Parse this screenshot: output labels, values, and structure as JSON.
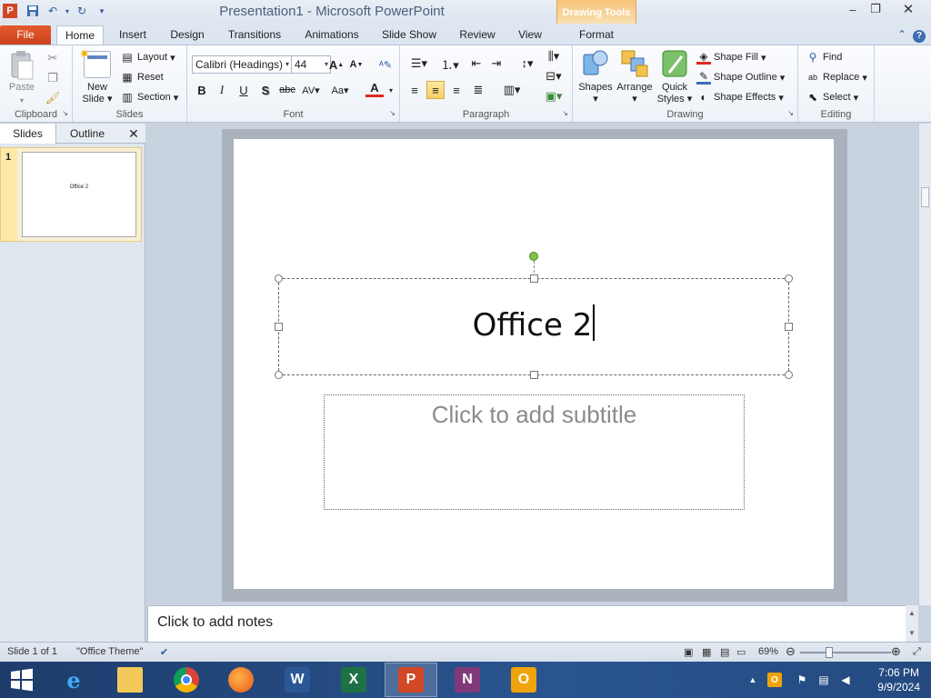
{
  "window": {
    "title": "Presentation1  -  Microsoft PowerPoint",
    "context_tab_group": "Drawing Tools"
  },
  "tabs": [
    "File",
    "Home",
    "Insert",
    "Design",
    "Transitions",
    "Animations",
    "Slide Show",
    "Review",
    "View",
    "Format"
  ],
  "ribbon": {
    "clipboard": {
      "label": "Clipboard",
      "paste": "Paste"
    },
    "slides": {
      "label": "Slides",
      "new_slide_1": "New",
      "new_slide_2": "Slide",
      "layout": "Layout",
      "reset": "Reset",
      "section": "Section"
    },
    "font": {
      "label": "Font",
      "font_name": "Calibri (Headings)",
      "font_size": "44"
    },
    "paragraph": {
      "label": "Paragraph"
    },
    "drawing": {
      "label": "Drawing",
      "shapes": "Shapes",
      "arrange": "Arrange",
      "quick_styles_1": "Quick",
      "quick_styles_2": "Styles",
      "shape_fill": "Shape Fill",
      "shape_outline": "Shape Outline",
      "shape_effects": "Shape Effects"
    },
    "editing": {
      "label": "Editing",
      "find": "Find",
      "replace": "Replace",
      "select": "Select"
    }
  },
  "left_panel": {
    "tabs": [
      "Slides",
      "Outline"
    ],
    "slide_number": "1",
    "thumb_text": "Office 2"
  },
  "slide": {
    "title_text": "Office 2",
    "subtitle_placeholder": "Click to add subtitle"
  },
  "notes": {
    "placeholder": "Click to add notes"
  },
  "status": {
    "slide_info": "Slide 1 of 1",
    "theme": "\"Office Theme\"",
    "zoom": "69%"
  },
  "taskbar": {
    "apps": [
      "start",
      "internet-explorer",
      "file-explorer",
      "chrome",
      "firefox",
      "word",
      "excel",
      "powerpoint",
      "onenote",
      "outlook"
    ],
    "time": "7:06 PM",
    "date": "9/9/2024"
  }
}
